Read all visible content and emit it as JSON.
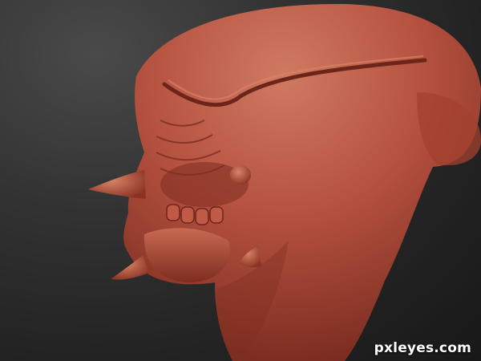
{
  "watermark": {
    "text": "pxleyes.com"
  },
  "colors": {
    "clay": "#b4503f",
    "clay_highlight": "#d77a63",
    "clay_shadow": "#6e2519",
    "background": "#2a2a2a"
  }
}
